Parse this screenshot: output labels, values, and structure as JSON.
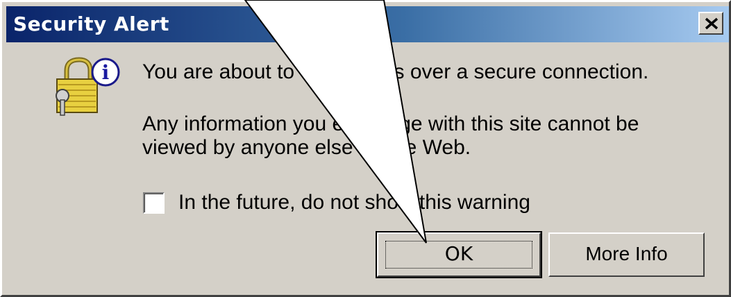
{
  "dialog": {
    "title": "Security Alert",
    "close_icon": "close-icon",
    "icon": "padlock-info-icon",
    "message_line1": "You are about to view pages over a secure connection.",
    "message_line2": "Any information you exchange with this site cannot be",
    "message_line3": "viewed by anyone else on the Web.",
    "checkbox_label": "In the future, do not show this warning",
    "checkbox_checked": false,
    "ok_label": "OK",
    "more_info_label": "More Info"
  },
  "colors": {
    "title_start": "#0a246a",
    "title_end": "#a6caf0",
    "face": "#d4d0c8"
  }
}
